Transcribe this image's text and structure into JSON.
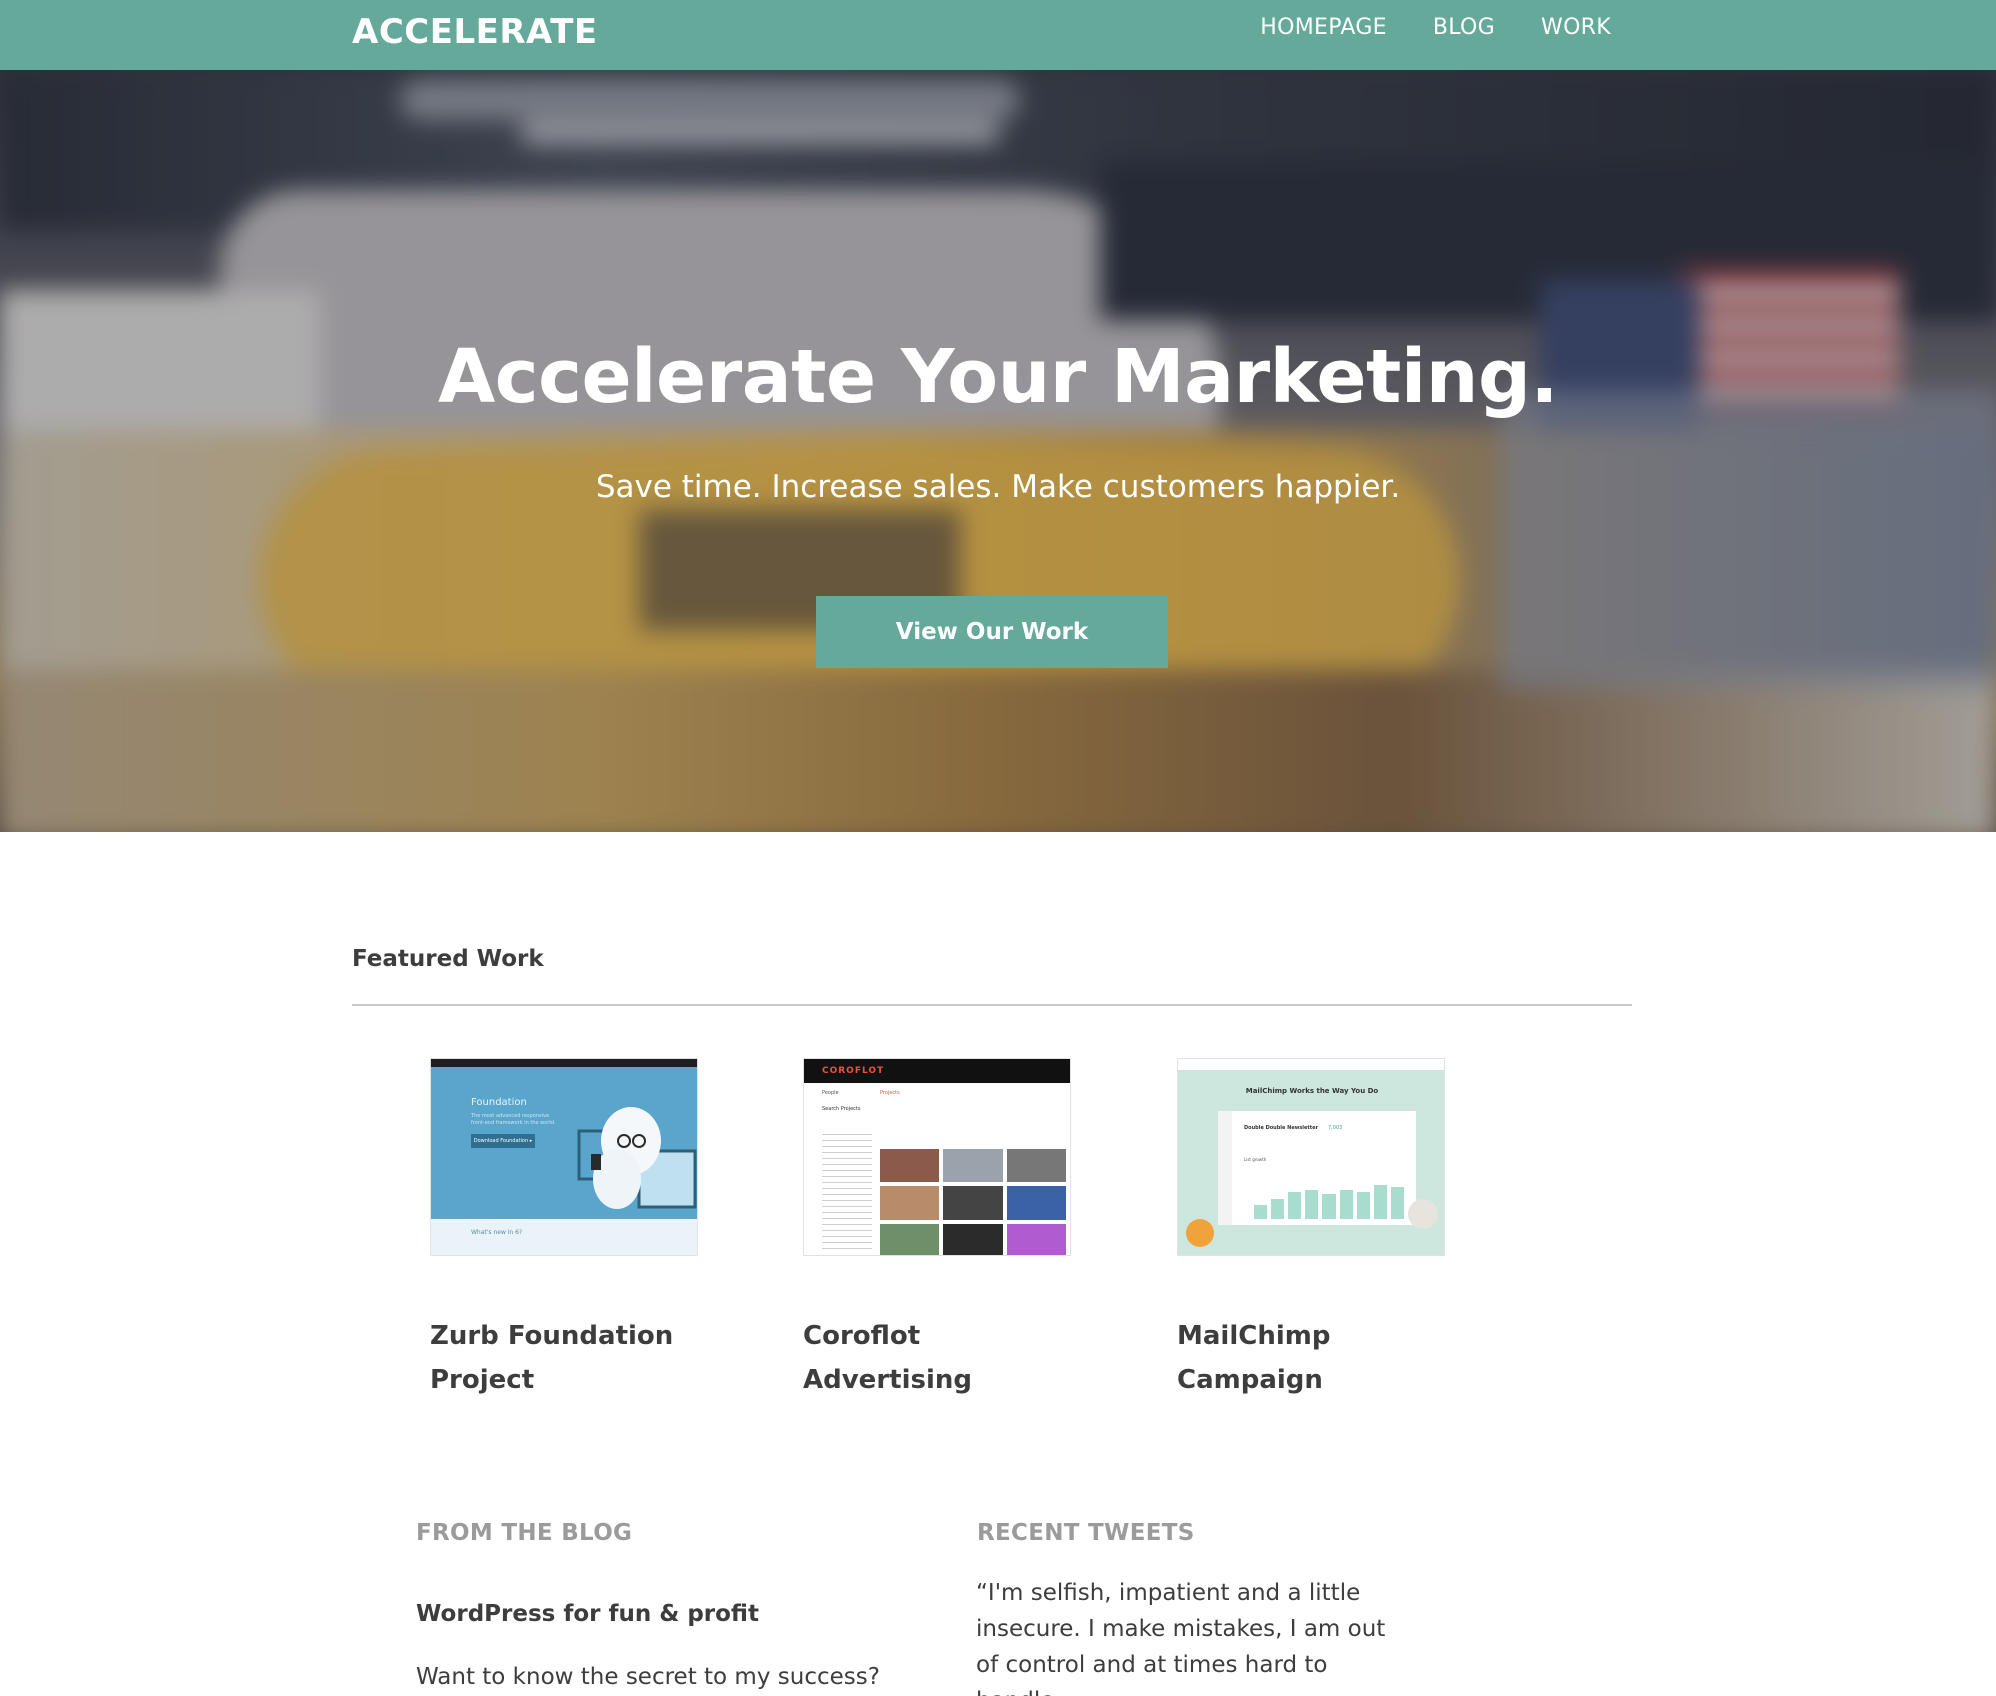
{
  "header": {
    "logo": "ACCELERATE",
    "nav": [
      "HOMEPAGE",
      "BLOG",
      "WORK"
    ]
  },
  "hero": {
    "title": "Accelerate Your Marketing.",
    "subtitle": "Save time. Increase sales. Make customers happier.",
    "cta_label": "View Our Work"
  },
  "featured": {
    "heading": "Featured Work",
    "items": [
      {
        "title": "Zurb Foundation Project",
        "thumb": {
          "header": "Foundation",
          "lines": [
            "The most advanced responsive",
            "front-end framework in the world."
          ],
          "button": "Download Foundation ▸",
          "footer": "What's new in 6?"
        }
      },
      {
        "title": "Coroflot Advertising",
        "thumb": {
          "brand": "COROFLOT",
          "tab1": "People",
          "tab2": "Projects",
          "label": "Search Projects"
        }
      },
      {
        "title": "MailChimp Campaign",
        "thumb": {
          "headline": "MailChimp Works the Way You Do",
          "card_title": "Double Double Newsletter",
          "card_value": "7,003",
          "card_label": "List growth"
        }
      }
    ]
  },
  "blog": {
    "heading": "FROM THE BLOG",
    "post_title": "WordPress for fun & profit",
    "excerpt": "Want to know the secret to my success?"
  },
  "tweets": {
    "heading": "RECENT TWEETS",
    "text": "“I'm selfish, impatient and a little insecure. I make mistakes, I am out of control and at times hard to handle."
  },
  "colors": {
    "accent": "#64a99a",
    "text": "#3d3d3d",
    "muted": "#9b9b9b"
  }
}
